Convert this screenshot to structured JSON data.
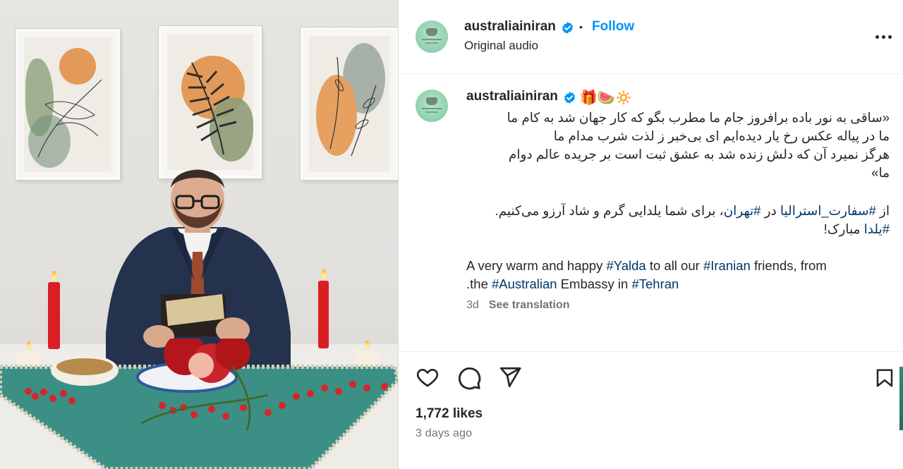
{
  "post": {
    "author": {
      "handle": "australiainiran",
      "verified": true,
      "follow_label": "Follow",
      "separator": "•",
      "audio_label": "Original audio"
    },
    "caption": {
      "handle": "australiainiran",
      "emojis": "🎁🍉🔅",
      "poem_lines": [
        "«ساقی به نور باده برافروز جام ما مطرب بگو که کار جهان شد به کام ما",
        "ما در پیاله عکس رخ یار دیده‌ایم ای بی‌خبر ز لذت شرب مدام ما",
        "هرگز نمیرد آن که دلش زنده شد به عشق ثبت است بر جریده عالم دوام",
        "ما»"
      ],
      "fa_line1_prefix": "از ",
      "fa_tag1": "#سفارت_استرالیا",
      "fa_line1_mid": " در ",
      "fa_tag2": "#تهران",
      "fa_line1_suffix": "، برای شما یلدایی گرم و شاد آرزو می‌کنیم.",
      "fa_tag3": "#یلدا",
      "fa_line2_suffix": " مبارک!",
      "en_part1": "A very warm and happy ",
      "en_tag_yalda": "#Yalda",
      "en_part2": " to all our ",
      "en_tag_iranian": "#Iranian",
      "en_part3": " friends, from",
      "en_part4": ".the ",
      "en_tag_australian": "#Australian",
      "en_part5": " Embassy in ",
      "en_tag_tehran": "#Tehran",
      "age": "3d",
      "see_translation": "See translation"
    },
    "likes": "1,772 likes",
    "posted": "3 days ago",
    "icons": [
      "heart-icon",
      "comment-icon",
      "share-icon",
      "bookmark-icon",
      "more-options-icon",
      "verified-badge-icon"
    ],
    "colors": {
      "link": "#0095f6",
      "hashtag": "#00376b",
      "verified": "#0095f6",
      "muted": "#737373"
    }
  }
}
